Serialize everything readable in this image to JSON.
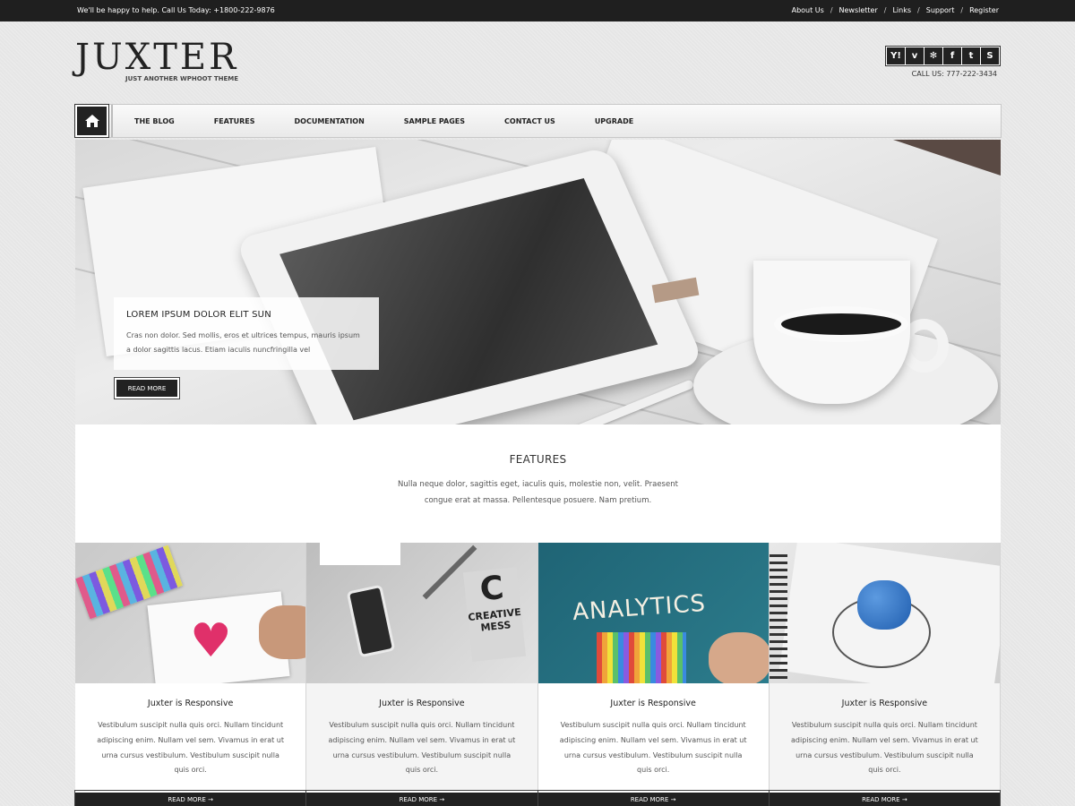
{
  "topbar": {
    "tagline": "We'll be happy to help. Call Us Today: +1800-222-9876",
    "links": [
      "About Us",
      "Newsletter",
      "Links",
      "Support",
      "Register"
    ],
    "separator": "/"
  },
  "header": {
    "site_name": "JUXTER",
    "site_tagline": "JUST ANOTHER WPHOOT THEME",
    "social_icons": [
      "yahoo-icon",
      "vimeo-icon",
      "yelp-icon",
      "facebook-icon",
      "twitter-icon",
      "skype-icon"
    ],
    "call_us": "CALL US: 777-222-3434"
  },
  "nav": {
    "home_icon": "home-icon",
    "items": [
      "THE BLOG",
      "FEATURES",
      "DOCUMENTATION",
      "SAMPLE PAGES",
      "CONTACT US",
      "UPGRADE"
    ]
  },
  "hero": {
    "title": "LOREM IPSUM DOLOR ELIT SUN",
    "text": "Cras non dolor. Sed mollis, eros et ultrices tempus, mauris ipsum a dolor sagittis lacus. Etiam iaculis nuncfringilla vel",
    "button": "READ MORE"
  },
  "features": {
    "title": "FEATURES",
    "text": "Nulla neque dolor, sagittis eget, iaculis quis, molestie non, velit. Praesent congue erat at massa. Pellentesque posuere. Nam pretium."
  },
  "cards": [
    {
      "title": "Juxter is Responsive",
      "text": "Vestibulum suscipit nulla quis orci. Nullam tincidunt adipiscing enim. Nullam vel sem. Vivamus in erat ut urna cursus vestibulum. Vestibulum suscipit nulla quis orci.",
      "button": "READ MORE →"
    },
    {
      "title": "Juxter is Responsive",
      "text": "Vestibulum suscipit nulla quis orci. Nullam tincidunt adipiscing enim. Nullam vel sem. Vivamus in erat ut urna cursus vestibulum. Vestibulum suscipit nulla quis orci.",
      "button": "READ MORE →",
      "image_text": [
        "C",
        "CREATIVE",
        "MESS"
      ]
    },
    {
      "title": "Juxter is Responsive",
      "text": "Vestibulum suscipit nulla quis orci. Nullam tincidunt adipiscing enim. Nullam vel sem. Vivamus in erat ut urna cursus vestibulum. Vestibulum suscipit nulla quis orci.",
      "button": "READ MORE →",
      "image_text": "ANALYTICS"
    },
    {
      "title": "Juxter is Responsive",
      "text": "Vestibulum suscipit nulla quis orci. Nullam tincidunt adipiscing enim. Nullam vel sem. Vivamus in erat ut urna cursus vestibulum. Vestibulum suscipit nulla quis orci.",
      "button": "READ MORE →"
    }
  ]
}
